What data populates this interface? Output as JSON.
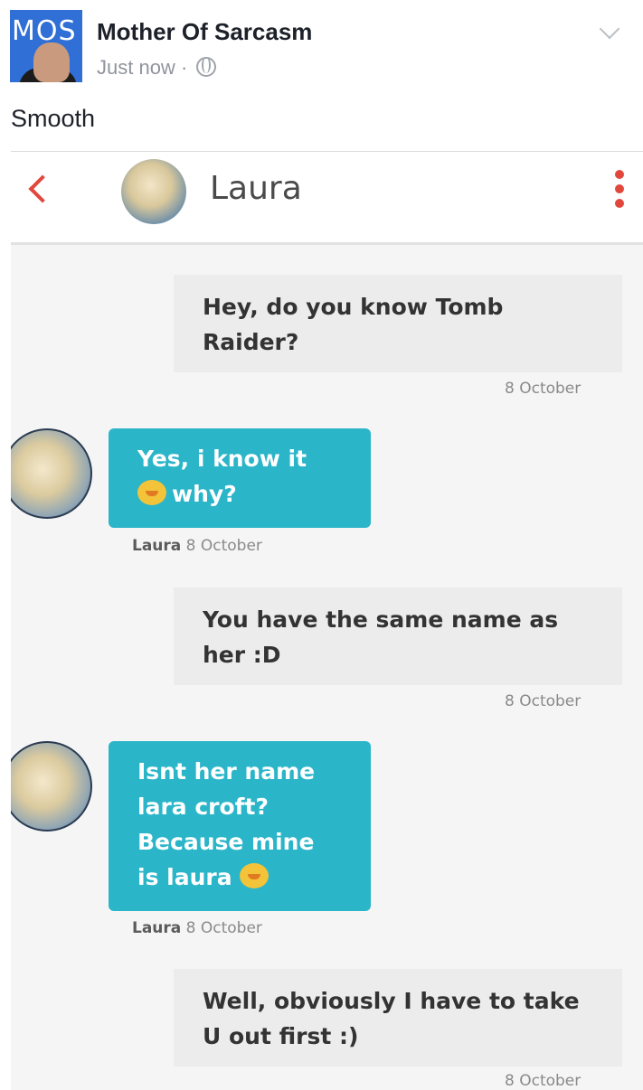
{
  "post": {
    "page_name": "Mother Of Sarcasm",
    "avatar_text": "MOS",
    "time": "Just now",
    "separator": "·",
    "text": "Smooth"
  },
  "chat": {
    "contact_name": "Laura",
    "messages": [
      {
        "direction": "out",
        "lines": [
          "Hey, do you know Tomb",
          "Raider?"
        ],
        "time": "8 October"
      },
      {
        "direction": "in",
        "lines": [
          "Yes, i know it",
          "why?"
        ],
        "sender": "Laura",
        "time": "8 October"
      },
      {
        "direction": "out",
        "lines": [
          "You have the same name as",
          "her :D"
        ],
        "time": "8 October"
      },
      {
        "direction": "in",
        "lines": [
          "Isnt her name",
          "lara croft?",
          "Because mine",
          "is laura"
        ],
        "sender": "Laura",
        "time": "8 October"
      },
      {
        "direction": "out",
        "lines": [
          "Well, obviously I have to take",
          "U out first :)"
        ],
        "time": "8 October"
      }
    ]
  },
  "colors": {
    "incoming_bubble": "#2bb5c9",
    "outgoing_bubble": "#ececec",
    "accent": "#e2473c"
  }
}
